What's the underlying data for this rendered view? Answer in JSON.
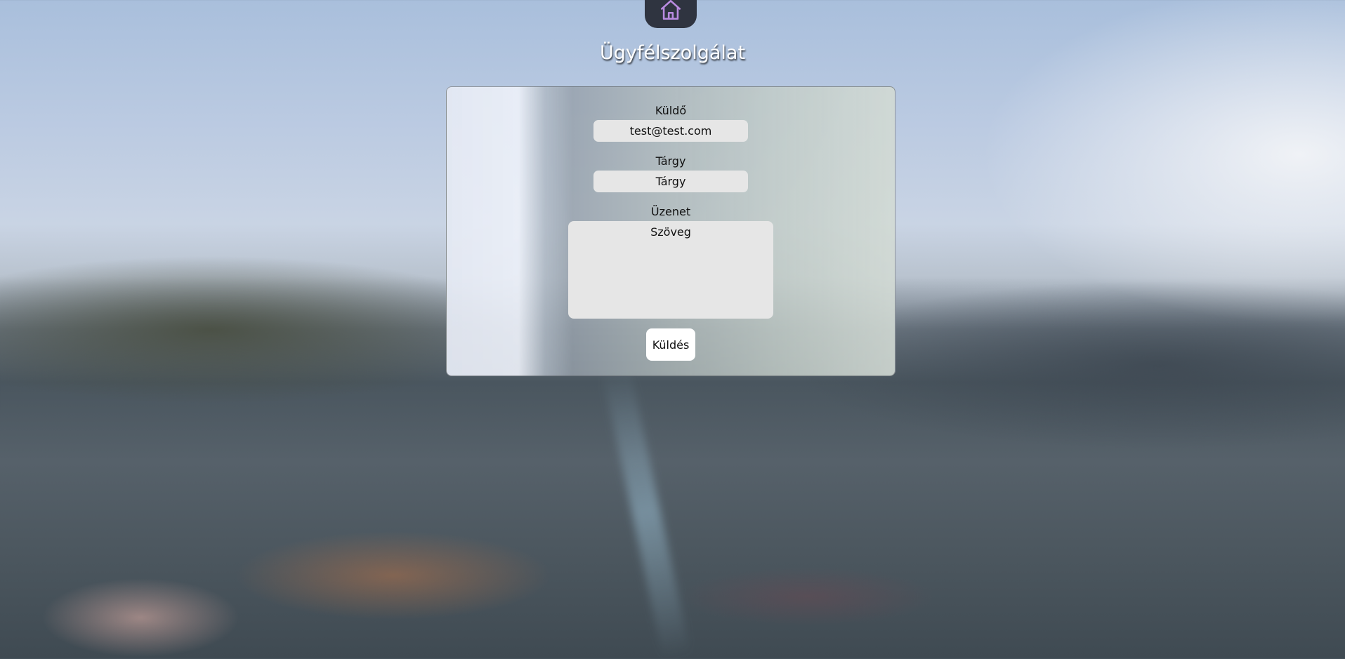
{
  "header": {
    "home_icon": "home-icon",
    "home_icon_color": "#b98be0",
    "title": "Ügyfélszolgálat"
  },
  "form": {
    "sender": {
      "label": "Küldő",
      "value": "test@test.com"
    },
    "subject": {
      "label": "Tárgy",
      "placeholder": "Tárgy"
    },
    "message": {
      "label": "Üzenet",
      "placeholder": "Szöveg"
    },
    "submit_label": "Küldés"
  }
}
